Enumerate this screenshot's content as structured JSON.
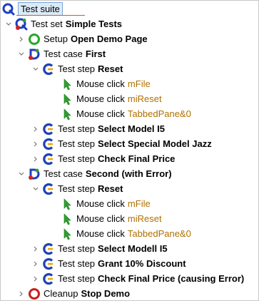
{
  "colors": {
    "test_set_blue": "#1f3fbf",
    "test_case_red": "#d42020",
    "step_blue": "#1e42b6",
    "step_orange": "#f0a000",
    "setup_green": "#29a829",
    "cleanup_red": "#c81e1e",
    "click_green": "#2fa02f",
    "target_text": "#b07000",
    "selection_bg": "#dbeaf7"
  },
  "tree": {
    "root": {
      "label": "Test suite",
      "icon": "test-suite-icon"
    },
    "rows": [
      {
        "kind": "Test set",
        "name": "Simple Tests",
        "icon": "test-set-icon",
        "expanded": true
      },
      {
        "kind": "Setup",
        "name": "Open Demo Page",
        "icon": "setup-icon",
        "expanded": false
      },
      {
        "kind": "Test case",
        "name": "First",
        "icon": "test-case-icon",
        "expanded": true
      },
      {
        "kind": "Test step",
        "name": "Reset",
        "icon": "test-step-icon",
        "expanded": true
      },
      {
        "kind": "Mouse click",
        "target": "mFile",
        "icon": "mouse-click-icon"
      },
      {
        "kind": "Mouse click",
        "target": "miReset",
        "icon": "mouse-click-icon"
      },
      {
        "kind": "Mouse click",
        "target": "TabbedPane&0",
        "icon": "mouse-click-icon"
      },
      {
        "kind": "Test step",
        "name": "Select Model I5",
        "icon": "test-step-icon",
        "expanded": false
      },
      {
        "kind": "Test step",
        "name": "Select Special Model Jazz",
        "icon": "test-step-icon",
        "expanded": false
      },
      {
        "kind": "Test step",
        "name": "Check Final Price",
        "icon": "test-step-icon",
        "expanded": false
      },
      {
        "kind": "Test case",
        "name": "Second (with Error)",
        "icon": "test-case-icon",
        "expanded": true
      },
      {
        "kind": "Test step",
        "name": "Reset",
        "icon": "test-step-icon",
        "expanded": true
      },
      {
        "kind": "Mouse click",
        "target": "mFile",
        "icon": "mouse-click-icon"
      },
      {
        "kind": "Mouse click",
        "target": "miReset",
        "icon": "mouse-click-icon"
      },
      {
        "kind": "Mouse click",
        "target": "TabbedPane&0",
        "icon": "mouse-click-icon"
      },
      {
        "kind": "Test step",
        "name": "Select Modell I5",
        "icon": "test-step-icon",
        "expanded": false
      },
      {
        "kind": "Test step",
        "name": "Grant 10% Discount",
        "icon": "test-step-icon",
        "expanded": false
      },
      {
        "kind": "Test step",
        "name": "Check Final Price (causing Error)",
        "icon": "test-step-icon",
        "expanded": false
      },
      {
        "kind": "Cleanup",
        "name": "Stop Demo",
        "icon": "cleanup-icon",
        "expanded": false
      }
    ]
  }
}
